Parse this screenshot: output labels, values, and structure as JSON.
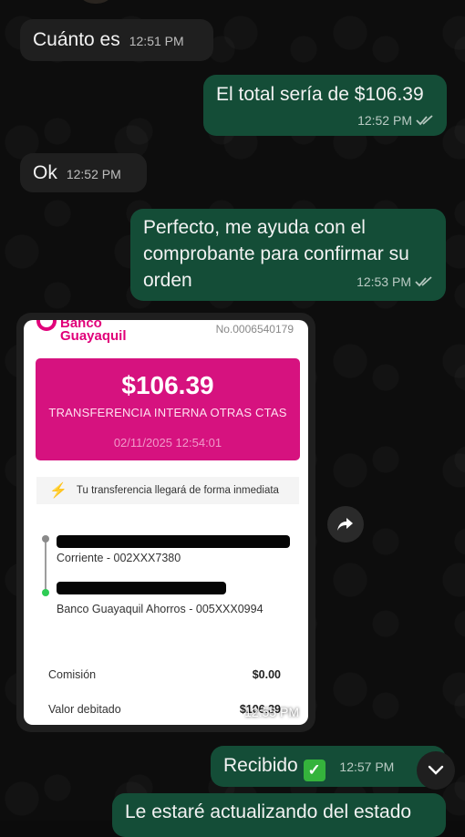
{
  "messages": [
    {
      "text": "Cuánto es",
      "time": "12:51 PM"
    },
    {
      "text": "El total sería de $106.39",
      "time": "12:52 PM"
    },
    {
      "text": "Ok",
      "time": "12:52 PM"
    },
    {
      "line1": "Perfecto, me ayuda con el",
      "line2": "comprobante para confirmar su",
      "line3": "orden",
      "time": "12:53 PM"
    }
  ],
  "receipt": {
    "bank_line1": "Banco",
    "bank_line2": "Guayaquil",
    "number": "No.0006540179",
    "amount": "$106.39",
    "transfer_type": "TRANSFERENCIA INTERNA OTRAS CTAS",
    "date": "02/11/2025 12:54:01",
    "notice": "Tu transferencia llegará de forma inmediata",
    "from_account": "Corriente - 002XXX7380",
    "to_account": "Banco Guayaquil Ahorros - 005XXX0994",
    "fee_label": "Comisión",
    "fee_value": "$0.00",
    "debit_label": "Valor debitado",
    "debit_value": "$106.39",
    "time": "12:55 PM"
  },
  "received": {
    "text": "Recibido",
    "emoji": "✓",
    "time": "12:57 PM"
  },
  "bottom_partial": "Le estaré actualizando del estado",
  "icons": {
    "forward": "forward-arrow-icon",
    "scroll": "chevron-down-icon",
    "read": "double-check-icon"
  },
  "colors": {
    "outgoing": "#144d37",
    "incoming": "#1f1f1f",
    "bank_pink": "#d6127f"
  }
}
